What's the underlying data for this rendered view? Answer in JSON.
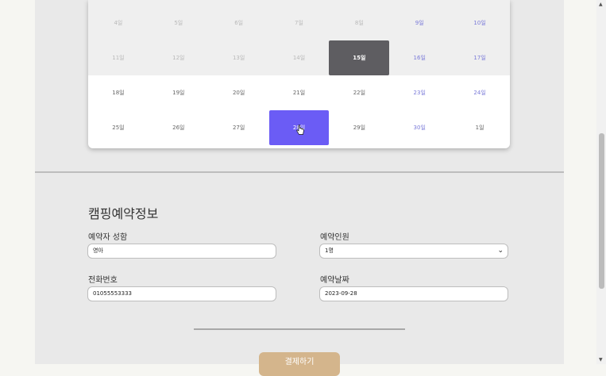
{
  "calendar": {
    "rows": [
      {
        "shade": true,
        "days": [
          {
            "label": "4일",
            "state": "past"
          },
          {
            "label": "5일",
            "state": "past"
          },
          {
            "label": "6일",
            "state": "past"
          },
          {
            "label": "7일",
            "state": "past"
          },
          {
            "label": "8일",
            "state": "past"
          },
          {
            "label": "9일",
            "state": "sat"
          },
          {
            "label": "10일",
            "state": "sat"
          }
        ]
      },
      {
        "shade": true,
        "days": [
          {
            "label": "11일",
            "state": "past"
          },
          {
            "label": "12일",
            "state": "past"
          },
          {
            "label": "13일",
            "state": "past"
          },
          {
            "label": "14일",
            "state": "past"
          },
          {
            "label": "15일",
            "state": "today"
          },
          {
            "label": "16일",
            "state": "sat"
          },
          {
            "label": "17일",
            "state": "sat"
          }
        ]
      },
      {
        "shade": false,
        "days": [
          {
            "label": "18일",
            "state": "normal"
          },
          {
            "label": "19일",
            "state": "normal"
          },
          {
            "label": "20일",
            "state": "normal"
          },
          {
            "label": "21일",
            "state": "normal"
          },
          {
            "label": "22일",
            "state": "normal"
          },
          {
            "label": "23일",
            "state": "sat"
          },
          {
            "label": "24일",
            "state": "sat"
          }
        ]
      },
      {
        "shade": false,
        "days": [
          {
            "label": "25일",
            "state": "normal"
          },
          {
            "label": "26일",
            "state": "normal"
          },
          {
            "label": "27일",
            "state": "normal"
          },
          {
            "label": "28일",
            "state": "selected"
          },
          {
            "label": "29일",
            "state": "normal"
          },
          {
            "label": "30일",
            "state": "sat"
          },
          {
            "label": "1일",
            "state": "normal"
          }
        ]
      }
    ]
  },
  "reservation": {
    "title": "캠핑예약정보",
    "name_label": "예약자 성함",
    "name_value": "영아",
    "people_label": "예약인원",
    "people_value": "1명",
    "phone_label": "전화번호",
    "phone_value": "01055553333",
    "date_label": "예약날짜",
    "date_value": "2023-09-28",
    "pay_button": "결제하기"
  },
  "colors": {
    "selected": "#6b5cf5",
    "today": "#5e5d61",
    "pay_button": "#d4b58c"
  }
}
